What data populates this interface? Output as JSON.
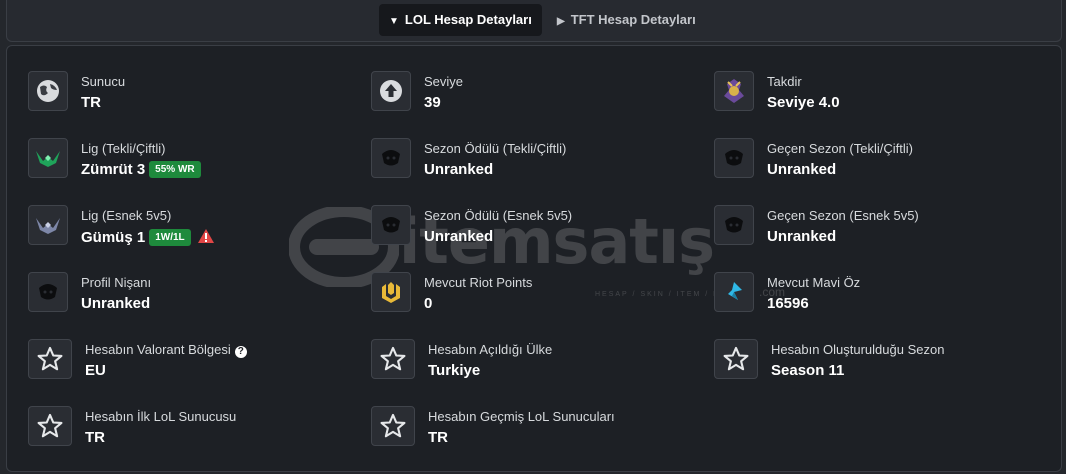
{
  "tabs": [
    {
      "label": "LOL Hesap Detayları",
      "active": true
    },
    {
      "label": "TFT Hesap Detayları",
      "active": false
    }
  ],
  "watermark": {
    "text": "itemsatış",
    "sub": "HESAP / SKIN / ITEM / E-PIN",
    "com": ".com"
  },
  "details": {
    "server": {
      "label": "Sunucu",
      "value": "TR",
      "icon": "globe-icon"
    },
    "level": {
      "label": "Seviye",
      "value": "39",
      "icon": "level-up-arrow-icon"
    },
    "honor": {
      "label": "Takdir",
      "value": "Seviye 4.0",
      "icon": "honor-emblem-icon"
    },
    "solo_league": {
      "label": "Lig (Tekli/Çiftli)",
      "value": "Zümrüt 3",
      "badge": "55% WR",
      "icon": "emerald-rank-icon"
    },
    "season_reward_solo": {
      "label": "Sezon Ödülü (Tekli/Çiftli)",
      "value": "Unranked",
      "icon": "unranked-icon"
    },
    "last_season_solo": {
      "label": "Geçen Sezon (Tekli/Çiftli)",
      "value": "Unranked",
      "icon": "unranked-icon"
    },
    "flex_league": {
      "label": "Lig (Esnek 5v5)",
      "value": "Gümüş 1",
      "badge": "1W/1L",
      "icon": "silver-rank-icon"
    },
    "season_reward_flex": {
      "label": "Sezon Ödülü (Esnek 5v5)",
      "value": "Unranked",
      "icon": "unranked-icon"
    },
    "last_season_flex": {
      "label": "Geçen Sezon (Esnek 5v5)",
      "value": "Unranked",
      "icon": "unranked-icon"
    },
    "profile_badge": {
      "label": "Profil Nişanı",
      "value": "Unranked",
      "icon": "unranked-icon"
    },
    "riot_points": {
      "label": "Mevcut Riot Points",
      "value": "0",
      "icon": "riot-points-icon"
    },
    "blue_essence": {
      "label": "Mevcut Mavi Öz",
      "value": "16596",
      "icon": "blue-essence-icon"
    },
    "valorant_region": {
      "label": "Hesabın Valorant Bölgesi",
      "value": "EU",
      "icon": "star-icon"
    },
    "country": {
      "label": "Hesabın Açıldığı Ülke",
      "value": "Turkiye",
      "icon": "star-icon"
    },
    "created_season": {
      "label": "Hesabın Oluşturulduğu Sezon",
      "value": "Season 11",
      "icon": "star-icon"
    },
    "first_server": {
      "label": "Hesabın İlk LoL Sunucusu",
      "value": "TR",
      "icon": "star-icon"
    },
    "past_servers": {
      "label": "Hesabın Geçmiş LoL Sunucuları",
      "value": "TR",
      "icon": "star-icon"
    }
  },
  "colors": {
    "badge_green": "#1e8a3c",
    "warning_red": "#e04646",
    "riot_points_gold": "#e8b938",
    "blue_essence": "#2fb8e6"
  }
}
